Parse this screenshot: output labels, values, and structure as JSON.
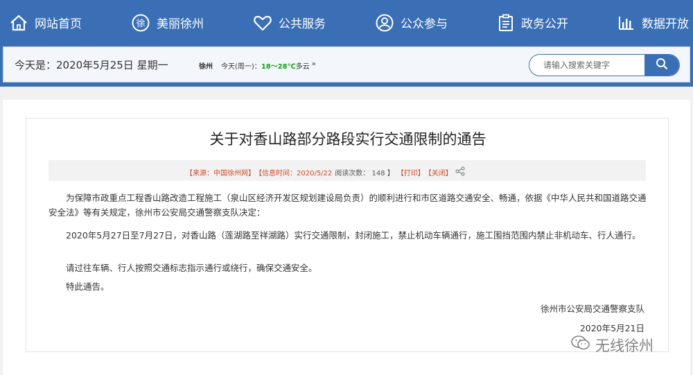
{
  "nav": {
    "items": [
      {
        "label": "网站首页",
        "icon": "home-icon"
      },
      {
        "label": "美丽徐州",
        "icon": "xu-seal-icon"
      },
      {
        "label": "公共服务",
        "icon": "heart-icon"
      },
      {
        "label": "公众参与",
        "icon": "user-circle-icon"
      },
      {
        "label": "政务公开",
        "icon": "clipboard-icon"
      },
      {
        "label": "数据开放",
        "icon": "bar-chart-icon"
      }
    ]
  },
  "strip": {
    "today": "今天是：2020年5月25日  星期一",
    "weather": {
      "city": "徐州",
      "day": "今天(周一)：",
      "temp": "18～28℃",
      "condition": "多云",
      "more": "»"
    },
    "search": {
      "placeholder": "请输入搜索关键字"
    }
  },
  "article": {
    "title": "关于对香山路部分路段实行交通限制的通告",
    "meta": {
      "source": "【来源：中国徐州网】",
      "time": "【信息时间：2020/5/22",
      "views": "阅读次数： 148 】",
      "print": "【打印】",
      "close": "【关闭】"
    },
    "paragraphs": [
      "为保障市政重点工程香山路改造工程施工（泉山区经济开发区规划建设局负责）的顺利进行和市区道路交通安全、畅通，依据《中华人民共和国道路交通安全法》等有关规定，徐州市公安局交通警察支队决定：",
      "2020年5月27日至7月27日，对香山路（莲湖路至祥湖路）实行交通限制，封闭施工，禁止机动车辆通行，施工围挡范围内禁止非机动车、行人通行。",
      "请过往车辆、行人按照交通标志指示通行或绕行，确保交通安全。",
      "特此通告。"
    ],
    "signature": "徐州市公安局交通警察支队",
    "date": "2020年5月21日"
  },
  "watermark": "无线徐州",
  "colors": {
    "brand": "#3a6fb5",
    "meta_red": "#cc4c2a",
    "temp_green": "#1aa21a"
  }
}
